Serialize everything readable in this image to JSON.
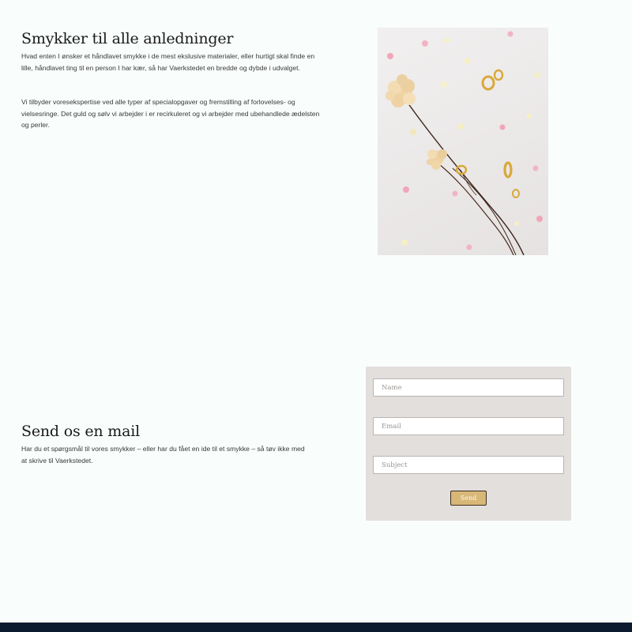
{
  "intro": {
    "title": "Smykker til alle anledninger",
    "paragraph_1": "Hvad enten I ønsker et håndlavet smykke i de mest ekslusive materialer, eller hurtigt skal finde en lille, håndlavet ting til en person I har kær, så har Vaerkstedet en bredde og dybde i udvalget.",
    "paragraph_2": "Vi tilbyder voresekspertise ved alle typer af specialopgaver og fremstilling af forlovelses- og vielsesringe. Det guld og sølv vi arbejder i er recirkuleret og vi arbejder med ubehandlede ædelsten og perler."
  },
  "photo": {
    "subject": "dried flowers and gold rings",
    "colors": {
      "background": "#ece9e9",
      "stem": "#3b2418",
      "flower": "#efd3a1",
      "gold": "#d8a93a"
    }
  },
  "contact": {
    "title": "Send os en mail",
    "text": "Har du et spørgsmål til vores smykker – eller har du fået en ide til et smykke – så tøv ikke med at skrive til Vaerkstedet.",
    "form": {
      "name_placeholder": "Name",
      "email_placeholder": "Email",
      "subject_placeholder": "Subject",
      "send_label": "Send"
    }
  },
  "colors": {
    "page_background": "#f9fdfc",
    "form_panel": "#e2dfdd",
    "send_button": "#d8b777",
    "footer": "#0b1a2f"
  }
}
